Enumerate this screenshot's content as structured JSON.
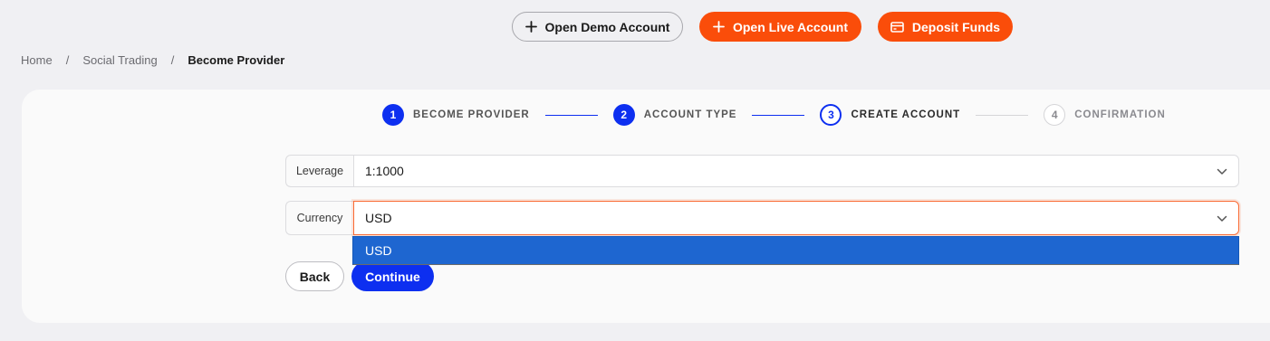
{
  "header": {
    "demo_label": "Open Demo Account",
    "live_label": "Open Live Account",
    "deposit_label": "Deposit Funds",
    "demo_icon": "plus-icon",
    "live_icon": "plus-icon",
    "deposit_icon": "card-icon"
  },
  "breadcrumb": {
    "items": [
      "Home",
      "Social Trading",
      "Become Provider"
    ],
    "separator": "/"
  },
  "stepper": {
    "steps": [
      {
        "number": "1",
        "label": "BECOME PROVIDER",
        "state": "done"
      },
      {
        "number": "2",
        "label": "ACCOUNT TYPE",
        "state": "done"
      },
      {
        "number": "3",
        "label": "CREATE ACCOUNT",
        "state": "active"
      },
      {
        "number": "4",
        "label": "CONFIRMATION",
        "state": "pending"
      }
    ]
  },
  "form": {
    "leverage": {
      "label": "Leverage",
      "value": "1:1000"
    },
    "currency": {
      "label": "Currency",
      "value": "USD",
      "options": [
        "USD"
      ],
      "highlighted_option": "USD"
    }
  },
  "actions": {
    "back_label": "Back",
    "continue_label": "Continue"
  },
  "colors": {
    "accent_orange": "#fa4d0a",
    "primary_blue": "#0d2ff0",
    "dropdown_highlight": "#1e66d0",
    "background": "#f0f0f3"
  }
}
